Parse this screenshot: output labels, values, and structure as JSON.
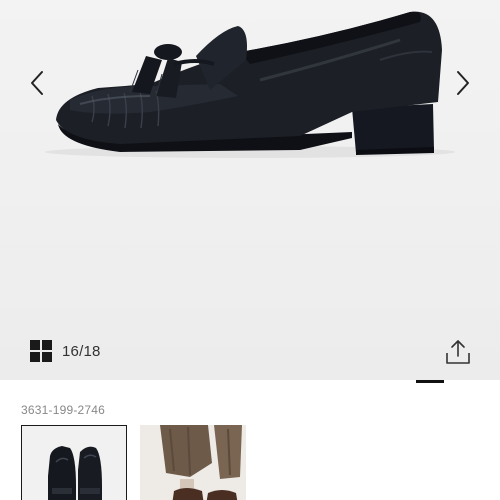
{
  "gallery": {
    "counter": "16/18",
    "current": 16,
    "total": 18,
    "icons": {
      "prev": "chevron-left-icon",
      "next": "chevron-right-icon",
      "grid": "grid-icon",
      "share": "share-icon"
    }
  },
  "product": {
    "sku": "3631-199-2746"
  },
  "thumbnails": [
    {
      "selected": true
    },
    {
      "selected": false
    }
  ],
  "colors": {
    "shoe": "#1c1f26",
    "accent": "#111111",
    "background": "#f0f0f0"
  }
}
